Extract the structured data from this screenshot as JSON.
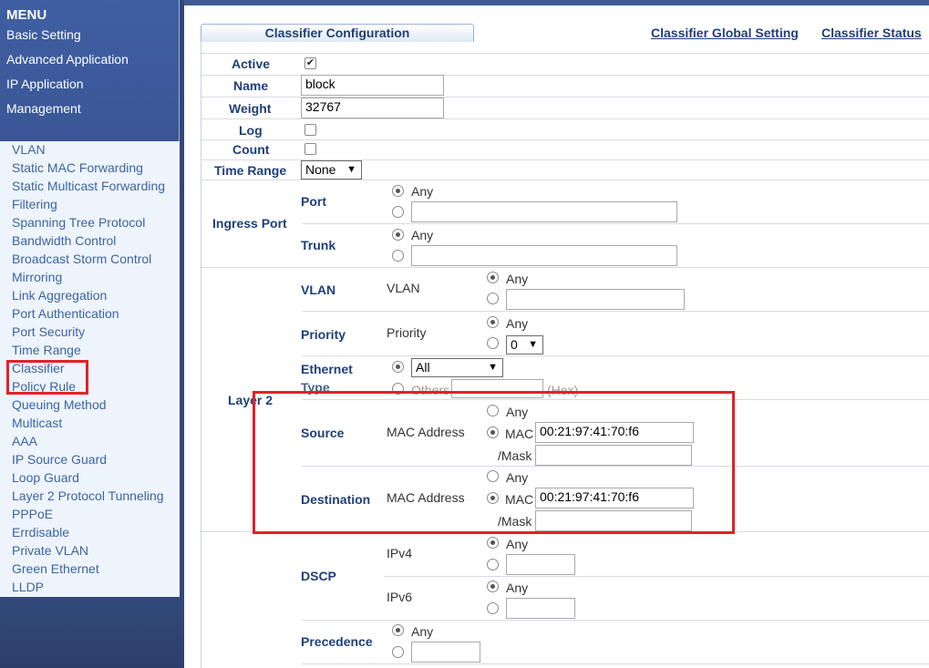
{
  "menu": {
    "title": "MENU",
    "top_links": [
      "Basic Setting",
      "Advanced Application",
      "IP Application",
      "Management"
    ],
    "sub_items": [
      "VLAN",
      "Static MAC Forwarding",
      "Static Multicast Forwarding",
      "Filtering",
      "Spanning Tree Protocol",
      "Bandwidth Control",
      "Broadcast Storm Control",
      "Mirroring",
      "Link Aggregation",
      "Port Authentication",
      "Port Security",
      "Time Range",
      "Classifier",
      "Policy Rule",
      "Queuing Method",
      "Multicast",
      "AAA",
      "IP Source Guard",
      "Loop Guard",
      "Layer 2 Protocol Tunneling",
      "PPPoE",
      "Errdisable",
      "Private VLAN",
      "Green Ethernet",
      "LLDP"
    ]
  },
  "tab": {
    "label": "Classifier Configuration"
  },
  "links": {
    "global_setting": "Classifier Global Setting",
    "status": "Classifier Status"
  },
  "form": {
    "active": {
      "label": "Active",
      "checked": true
    },
    "name": {
      "label": "Name",
      "value": "block"
    },
    "weight": {
      "label": "Weight",
      "value": "32767"
    },
    "log": {
      "label": "Log"
    },
    "count": {
      "label": "Count"
    },
    "time_range": {
      "label": "Time Range",
      "value": "None"
    },
    "ingress_port": {
      "label": "Ingress Port",
      "port_label": "Port",
      "trunk_label": "Trunk",
      "any": "Any"
    },
    "layer2": {
      "label": "Layer 2",
      "vlan": {
        "label": "VLAN",
        "sub": "VLAN",
        "any": "Any"
      },
      "priority": {
        "label": "Priority",
        "sub": "Priority",
        "any": "Any",
        "value": "0"
      },
      "ethernet_type": {
        "label": "Ethernet",
        "label2": "Type",
        "value": "All",
        "others": "Others",
        "hex": "(Hex)"
      },
      "source": {
        "label": "Source",
        "sub": "MAC Address",
        "any": "Any",
        "mac": "MAC",
        "mac_value": "00:21:97:41:70:f6",
        "mask": "/Mask"
      },
      "destination": {
        "label": "Destination",
        "sub": "MAC Address",
        "any": "Any",
        "mac": "MAC",
        "mac_value": "00:21:97:41:70:f6",
        "mask": "/Mask"
      }
    },
    "dscp": {
      "label": "DSCP",
      "ipv4": "IPv4",
      "ipv6": "IPv6",
      "any": "Any"
    },
    "precedence": {
      "label": "Precedence",
      "any": "Any"
    }
  },
  "colors": {
    "highlight": "#e0222a",
    "label": "#1f3f7a",
    "menu": "#3a5696"
  }
}
